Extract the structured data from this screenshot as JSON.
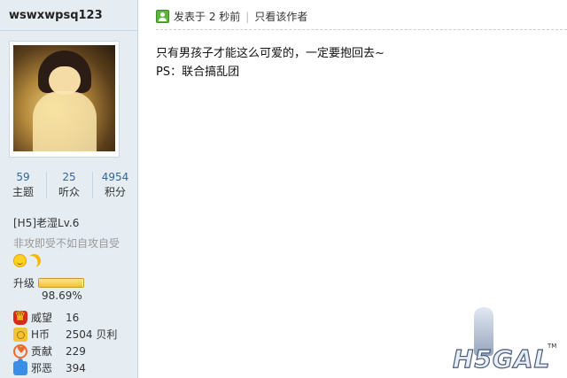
{
  "user": {
    "name": "wswxwpsq123",
    "stats": [
      {
        "value": "59",
        "label": "主题"
      },
      {
        "value": "25",
        "label": "听众"
      },
      {
        "value": "4954",
        "label": "积分"
      }
    ],
    "level": "[H5]老湿Lv.6",
    "motto": "非攻即受不如自攻自受",
    "upgrade": {
      "label": "升级",
      "percent_text": "98.69%",
      "progress_fraction": 0.9869
    },
    "props": [
      {
        "name": "威望",
        "value": "16",
        "icon": "crown-icon"
      },
      {
        "name": "H币",
        "value": "2504 贝利",
        "icon": "coin-icon"
      },
      {
        "name": "贡献",
        "value": "229",
        "icon": "heart-icon"
      },
      {
        "name": "邪恶",
        "value": "394",
        "icon": "puzzle-icon"
      }
    ]
  },
  "post": {
    "time": "发表于 2 秒前",
    "author_only": "只看该作者",
    "lines": [
      "只有男孩子才能这么可爱的，一定要抱回去~",
      "PS：联合搞乱团"
    ]
  },
  "watermark": {
    "text": "H5GAL",
    "tm": "TM"
  },
  "colors": {
    "sidebar_bg": "#e5edf2",
    "link_blue": "#336699",
    "progress_gold": "#f4c23a"
  }
}
